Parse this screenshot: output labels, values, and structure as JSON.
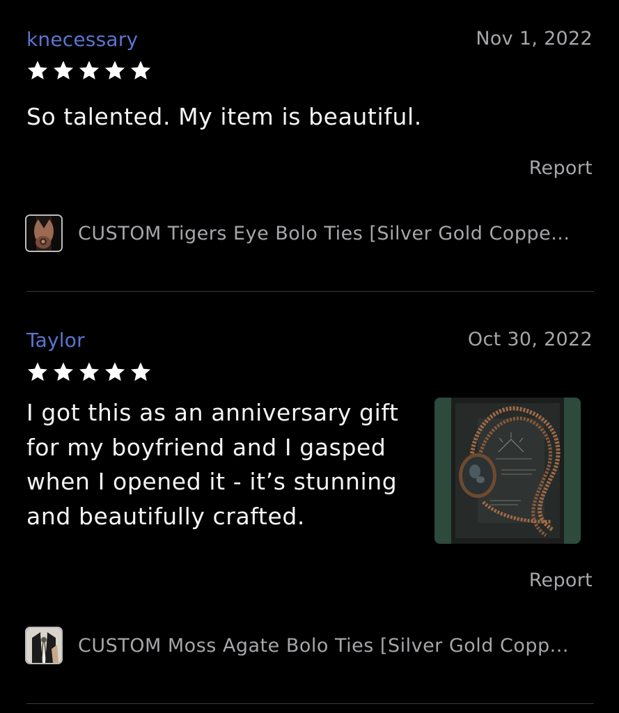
{
  "reviews": [
    {
      "reviewer": "knecessary",
      "date": "Nov 1, 2022",
      "rating": 5,
      "text": "So talented. My item is beautiful.",
      "report_label": "Report",
      "item_title": "CUSTOM Tigers Eye Bolo Ties [Silver Gold Coppe..."
    },
    {
      "reviewer": "Taylor",
      "date": "Oct 30, 2022",
      "rating": 5,
      "text_lines": [
        "I got this as an anniversary gift",
        "for my boyfriend and I gasped",
        "when I opened it - it’s stunning",
        "and beautifully crafted."
      ],
      "report_label": "Report",
      "item_title": "CUSTOM Moss Agate Bolo Ties [Silver Gold Copp..."
    }
  ],
  "colors": {
    "background": "#000000",
    "reviewer_name": "#5b74cf",
    "muted_text": "#a7a7ab",
    "body_text": "#f5f5f5",
    "divider": "#3a3a3c"
  },
  "icons": {
    "star": "star-icon"
  }
}
